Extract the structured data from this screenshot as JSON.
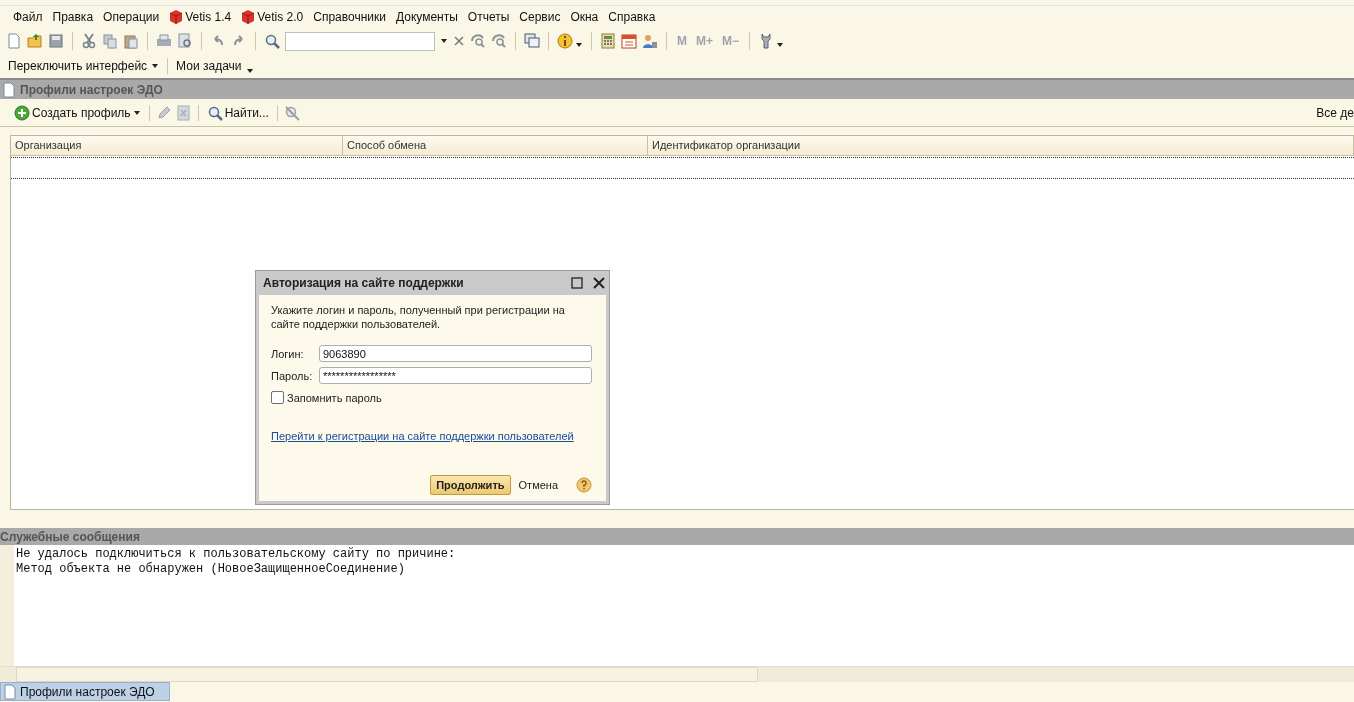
{
  "menu": [
    {
      "label": "Файл",
      "kind": "text"
    },
    {
      "label": "Правка",
      "kind": "text"
    },
    {
      "label": "Операции",
      "kind": "text"
    },
    {
      "label": "Vetis 1.4",
      "kind": "cube"
    },
    {
      "label": "Vetis 2.0",
      "kind": "cube"
    },
    {
      "label": "Справочники",
      "kind": "text"
    },
    {
      "label": "Документы",
      "kind": "text"
    },
    {
      "label": "Отчеты",
      "kind": "text"
    },
    {
      "label": "Сервис",
      "kind": "text"
    },
    {
      "label": "Окна",
      "kind": "text"
    },
    {
      "label": "Справка",
      "kind": "text"
    }
  ],
  "toolbar": {
    "memory_buttons": [
      "M",
      "M+",
      "M−"
    ]
  },
  "interface_bar": [
    "Переключить интерфейс",
    "Мои задачи"
  ],
  "form": {
    "title": "Профили настроек ЭДО",
    "create_button": "Создать профиль",
    "find_button": "Найти...",
    "all_actions": "Все де",
    "columns": [
      "Организация",
      "Способ обмена",
      "Идентификатор организации"
    ]
  },
  "dialog": {
    "title": "Авторизация на сайте поддержки",
    "intro": "Укажите логин и пароль, полученный при регистрации на сайте поддержки пользователей.",
    "fields": [
      {
        "label": "Логин:",
        "value": "9063890"
      },
      {
        "label": "Пароль:",
        "value": "*****************"
      }
    ],
    "remember": {
      "label": "Запомнить пароль",
      "checked": false
    },
    "link": "Перейти к регистрации на сайте поддержки пользователей",
    "buttons": [
      {
        "label": "Продолжить",
        "kind": "default"
      },
      {
        "label": "Отмена",
        "kind": "flat"
      }
    ]
  },
  "messages": {
    "title": "Служебные сообщения",
    "lines": [
      "Не удалось подключиться к пользовательскому сайту по причине:",
      "Метод объекта не обнаружен (НовоеЗащищенноеСоединение)"
    ]
  },
  "taskbar": [
    {
      "label": "Профили настроек ЭДО",
      "selected": true
    }
  ]
}
